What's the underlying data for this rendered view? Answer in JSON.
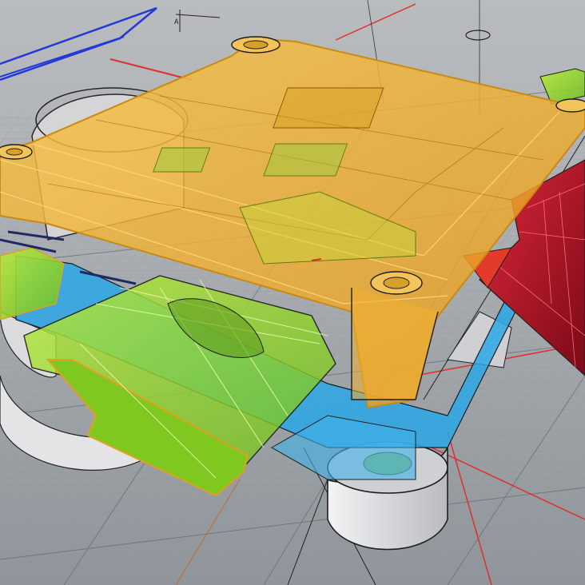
{
  "viewport": {
    "label": "perspective-viewport",
    "colors": {
      "background": "#aeb2b6",
      "grid_minor": "#8d949a",
      "grid_major": "#5f666c",
      "axis_x": "#e0302a",
      "axis_y": "#d04a3a",
      "construction_blue": "#2338d8",
      "enclosure_lid": "#f2b437",
      "enclosure_lid_edge": "#c98a10",
      "enclosure_base": "#2aa7e6",
      "connector_green": "#8fd42a",
      "connector_edge": "#e0a020",
      "part_red": "#c4142a",
      "boss_white": "#e8e8ea",
      "edge_black": "#1e1e1e"
    }
  },
  "annotation": {
    "text": "A"
  }
}
